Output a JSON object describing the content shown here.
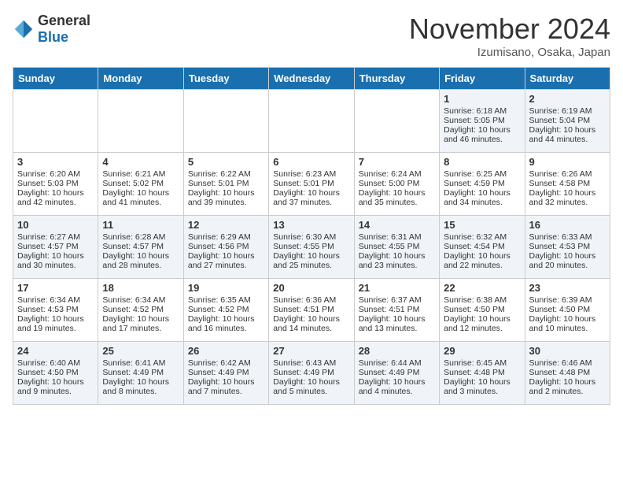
{
  "logo": {
    "text_general": "General",
    "text_blue": "Blue"
  },
  "header": {
    "month_title": "November 2024",
    "subtitle": "Izumisano, Osaka, Japan"
  },
  "days_of_week": [
    "Sunday",
    "Monday",
    "Tuesday",
    "Wednesday",
    "Thursday",
    "Friday",
    "Saturday"
  ],
  "weeks": [
    [
      {
        "day": "",
        "content": ""
      },
      {
        "day": "",
        "content": ""
      },
      {
        "day": "",
        "content": ""
      },
      {
        "day": "",
        "content": ""
      },
      {
        "day": "",
        "content": ""
      },
      {
        "day": "1",
        "content": "Sunrise: 6:18 AM\nSunset: 5:05 PM\nDaylight: 10 hours and 46 minutes."
      },
      {
        "day": "2",
        "content": "Sunrise: 6:19 AM\nSunset: 5:04 PM\nDaylight: 10 hours and 44 minutes."
      }
    ],
    [
      {
        "day": "3",
        "content": "Sunrise: 6:20 AM\nSunset: 5:03 PM\nDaylight: 10 hours and 42 minutes."
      },
      {
        "day": "4",
        "content": "Sunrise: 6:21 AM\nSunset: 5:02 PM\nDaylight: 10 hours and 41 minutes."
      },
      {
        "day": "5",
        "content": "Sunrise: 6:22 AM\nSunset: 5:01 PM\nDaylight: 10 hours and 39 minutes."
      },
      {
        "day": "6",
        "content": "Sunrise: 6:23 AM\nSunset: 5:01 PM\nDaylight: 10 hours and 37 minutes."
      },
      {
        "day": "7",
        "content": "Sunrise: 6:24 AM\nSunset: 5:00 PM\nDaylight: 10 hours and 35 minutes."
      },
      {
        "day": "8",
        "content": "Sunrise: 6:25 AM\nSunset: 4:59 PM\nDaylight: 10 hours and 34 minutes."
      },
      {
        "day": "9",
        "content": "Sunrise: 6:26 AM\nSunset: 4:58 PM\nDaylight: 10 hours and 32 minutes."
      }
    ],
    [
      {
        "day": "10",
        "content": "Sunrise: 6:27 AM\nSunset: 4:57 PM\nDaylight: 10 hours and 30 minutes."
      },
      {
        "day": "11",
        "content": "Sunrise: 6:28 AM\nSunset: 4:57 PM\nDaylight: 10 hours and 28 minutes."
      },
      {
        "day": "12",
        "content": "Sunrise: 6:29 AM\nSunset: 4:56 PM\nDaylight: 10 hours and 27 minutes."
      },
      {
        "day": "13",
        "content": "Sunrise: 6:30 AM\nSunset: 4:55 PM\nDaylight: 10 hours and 25 minutes."
      },
      {
        "day": "14",
        "content": "Sunrise: 6:31 AM\nSunset: 4:55 PM\nDaylight: 10 hours and 23 minutes."
      },
      {
        "day": "15",
        "content": "Sunrise: 6:32 AM\nSunset: 4:54 PM\nDaylight: 10 hours and 22 minutes."
      },
      {
        "day": "16",
        "content": "Sunrise: 6:33 AM\nSunset: 4:53 PM\nDaylight: 10 hours and 20 minutes."
      }
    ],
    [
      {
        "day": "17",
        "content": "Sunrise: 6:34 AM\nSunset: 4:53 PM\nDaylight: 10 hours and 19 minutes."
      },
      {
        "day": "18",
        "content": "Sunrise: 6:34 AM\nSunset: 4:52 PM\nDaylight: 10 hours and 17 minutes."
      },
      {
        "day": "19",
        "content": "Sunrise: 6:35 AM\nSunset: 4:52 PM\nDaylight: 10 hours and 16 minutes."
      },
      {
        "day": "20",
        "content": "Sunrise: 6:36 AM\nSunset: 4:51 PM\nDaylight: 10 hours and 14 minutes."
      },
      {
        "day": "21",
        "content": "Sunrise: 6:37 AM\nSunset: 4:51 PM\nDaylight: 10 hours and 13 minutes."
      },
      {
        "day": "22",
        "content": "Sunrise: 6:38 AM\nSunset: 4:50 PM\nDaylight: 10 hours and 12 minutes."
      },
      {
        "day": "23",
        "content": "Sunrise: 6:39 AM\nSunset: 4:50 PM\nDaylight: 10 hours and 10 minutes."
      }
    ],
    [
      {
        "day": "24",
        "content": "Sunrise: 6:40 AM\nSunset: 4:50 PM\nDaylight: 10 hours and 9 minutes."
      },
      {
        "day": "25",
        "content": "Sunrise: 6:41 AM\nSunset: 4:49 PM\nDaylight: 10 hours and 8 minutes."
      },
      {
        "day": "26",
        "content": "Sunrise: 6:42 AM\nSunset: 4:49 PM\nDaylight: 10 hours and 7 minutes."
      },
      {
        "day": "27",
        "content": "Sunrise: 6:43 AM\nSunset: 4:49 PM\nDaylight: 10 hours and 5 minutes."
      },
      {
        "day": "28",
        "content": "Sunrise: 6:44 AM\nSunset: 4:49 PM\nDaylight: 10 hours and 4 minutes."
      },
      {
        "day": "29",
        "content": "Sunrise: 6:45 AM\nSunset: 4:48 PM\nDaylight: 10 hours and 3 minutes."
      },
      {
        "day": "30",
        "content": "Sunrise: 6:46 AM\nSunset: 4:48 PM\nDaylight: 10 hours and 2 minutes."
      }
    ]
  ]
}
